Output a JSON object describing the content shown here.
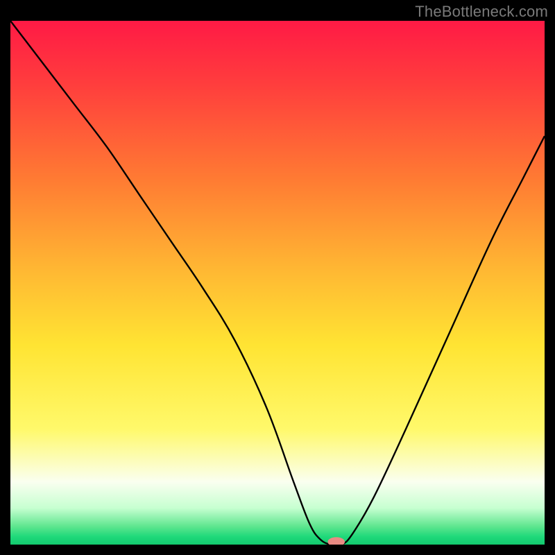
{
  "watermark": "TheBottleneck.com",
  "chart_data": {
    "type": "line",
    "title": "",
    "xlabel": "",
    "ylabel": "",
    "xlim": [
      0,
      100
    ],
    "ylim": [
      0,
      100
    ],
    "grid": false,
    "legend": false,
    "background_gradient": {
      "stops": [
        {
          "offset": 0.0,
          "color": "#ff1a45"
        },
        {
          "offset": 0.12,
          "color": "#ff3d3d"
        },
        {
          "offset": 0.3,
          "color": "#ff7a33"
        },
        {
          "offset": 0.48,
          "color": "#ffb933"
        },
        {
          "offset": 0.62,
          "color": "#ffe433"
        },
        {
          "offset": 0.78,
          "color": "#fff96b"
        },
        {
          "offset": 0.88,
          "color": "#fafff0"
        },
        {
          "offset": 0.93,
          "color": "#c7ffd1"
        },
        {
          "offset": 0.965,
          "color": "#5fe68f"
        },
        {
          "offset": 0.985,
          "color": "#1fd97a"
        },
        {
          "offset": 1.0,
          "color": "#12c96e"
        }
      ]
    },
    "series": [
      {
        "name": "bottleneck-curve",
        "type": "line",
        "color": "#000000",
        "x": [
          0,
          6,
          12,
          18,
          24,
          30,
          36,
          42,
          48,
          53,
          56,
          58,
          60,
          62,
          64,
          68,
          74,
          82,
          90,
          96,
          100
        ],
        "y": [
          100,
          92,
          84,
          76,
          67,
          58,
          49,
          39,
          26,
          12,
          4,
          1,
          0,
          0,
          2,
          9,
          22,
          40,
          58,
          70,
          78
        ]
      }
    ],
    "marker": {
      "name": "optimal-point",
      "x": 61,
      "y": 0,
      "color": "#e98b84",
      "rx": 1.6,
      "ry": 0.9
    }
  }
}
